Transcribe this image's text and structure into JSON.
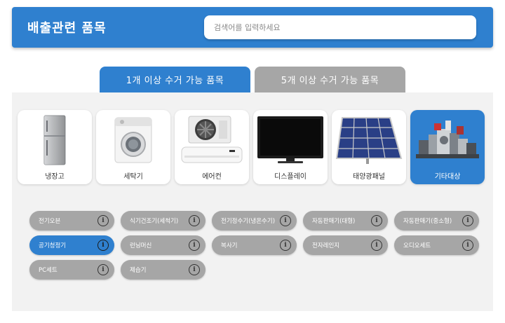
{
  "header": {
    "title": "배출관련 품목",
    "search_placeholder": "검색어를 입력하세요"
  },
  "tabs": [
    {
      "label": "1개 이상 수거 가능 품목",
      "active": true
    },
    {
      "label": "5개 이상 수거 가능 품목",
      "active": false
    }
  ],
  "categories": [
    {
      "label": "냉장고",
      "icon": "fridge-icon",
      "active": false
    },
    {
      "label": "세탁기",
      "icon": "washing-machine-icon",
      "active": false
    },
    {
      "label": "에어컨",
      "icon": "air-conditioner-icon",
      "active": false
    },
    {
      "label": "디스플레이",
      "icon": "display-icon",
      "active": false
    },
    {
      "label": "태양광패널",
      "icon": "solar-panel-icon",
      "active": false
    },
    {
      "label": "기타대상",
      "icon": "misc-appliances-icon",
      "active": true
    }
  ],
  "items": [
    {
      "label": "전기오븐",
      "active": false
    },
    {
      "label": "식기건조기(세척기)",
      "active": false
    },
    {
      "label": "전기정수기(냉온수기)",
      "active": false
    },
    {
      "label": "자동판매기(대형)",
      "active": false
    },
    {
      "label": "자동판매기(중소형)",
      "active": false
    },
    {
      "label": "공기청정기",
      "active": true
    },
    {
      "label": "런닝머신",
      "active": false
    },
    {
      "label": "복사기",
      "active": false
    },
    {
      "label": "전자레인지",
      "active": false
    },
    {
      "label": "오디오세트",
      "active": false
    },
    {
      "label": "PC세트",
      "active": false
    },
    {
      "label": "제습기",
      "active": false
    }
  ],
  "info_glyph": "i",
  "colors": {
    "accent": "#2f80cf",
    "chip_inactive": "#a6a6a6",
    "panel_bg": "#f2f2f2"
  }
}
